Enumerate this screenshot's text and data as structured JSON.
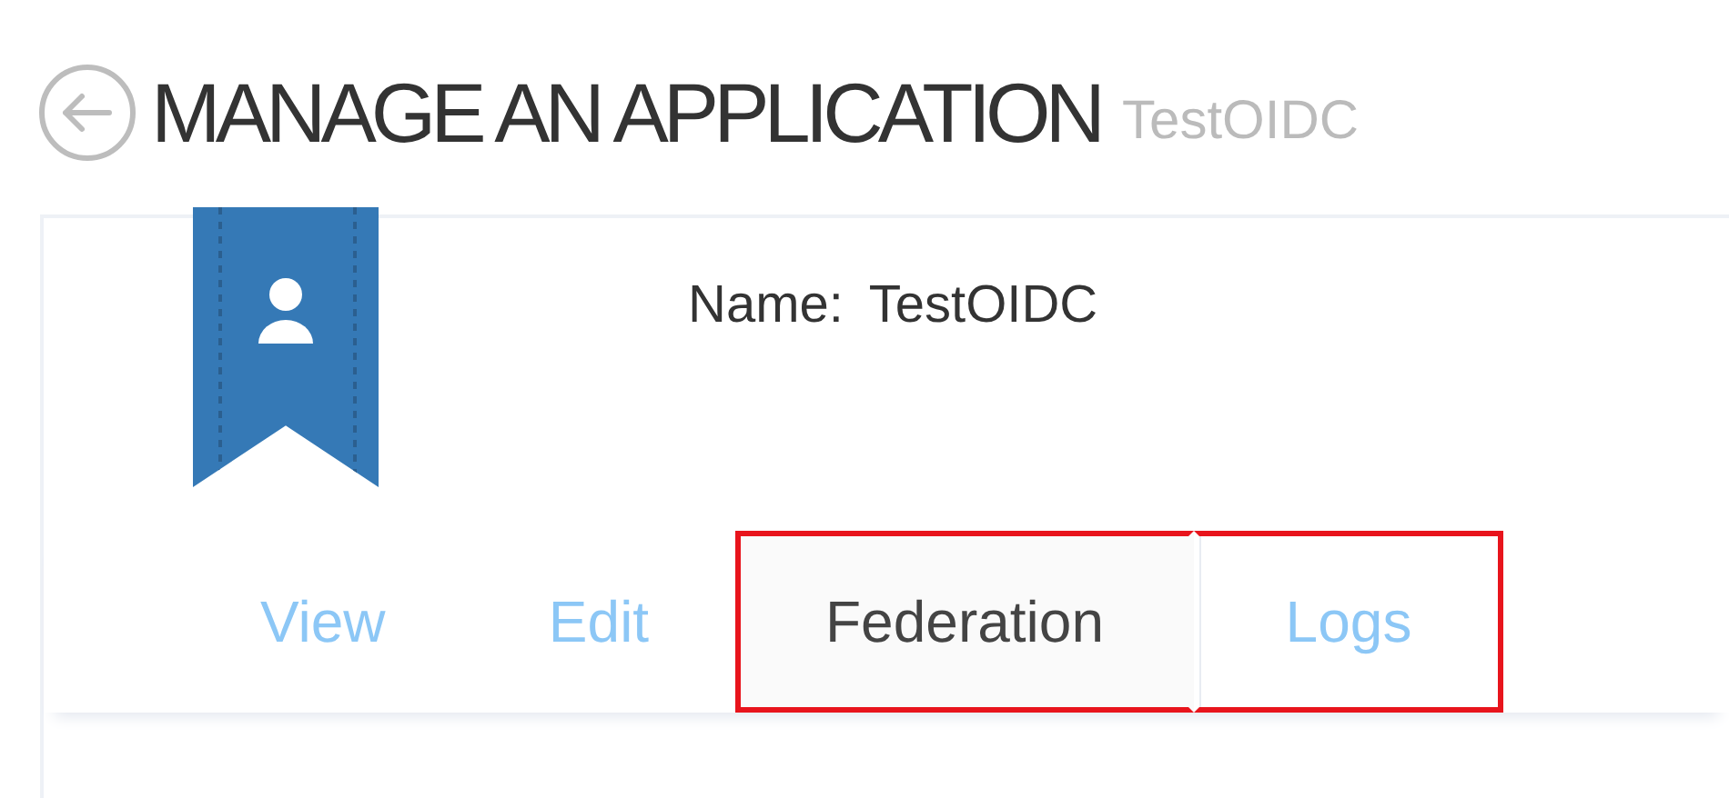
{
  "page": {
    "title": "MANAGE AN APPLICATION",
    "subtitle": "TestOIDC"
  },
  "app": {
    "name_label": "Name:",
    "name_value": "TestOIDC"
  },
  "tabs": [
    {
      "label": "View",
      "selected": false,
      "highlighted": false
    },
    {
      "label": "Edit",
      "selected": false,
      "highlighted": false
    },
    {
      "label": "Federation",
      "selected": true,
      "highlighted": true
    },
    {
      "label": "Logs",
      "selected": false,
      "highlighted": true
    }
  ]
}
